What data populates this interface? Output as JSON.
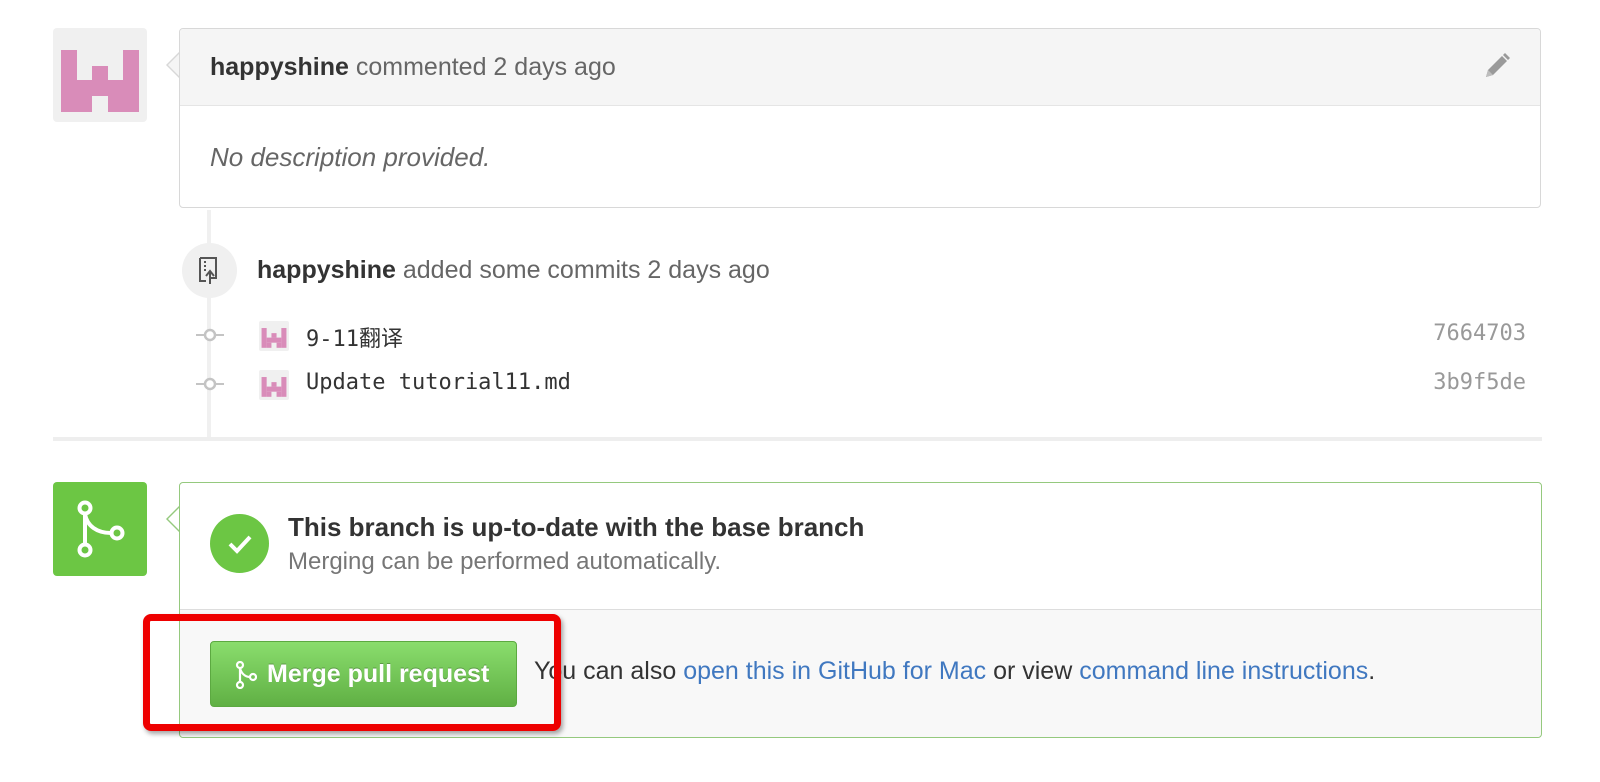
{
  "comment": {
    "author": "happyshine",
    "action": "commented 2 days ago",
    "body": "No description provided."
  },
  "commit_event": {
    "author": "happyshine",
    "action": "added some commits 2 days ago",
    "commits": [
      {
        "message": "9-11翻译",
        "sha": "7664703"
      },
      {
        "message": "Update tutorial11.md",
        "sha": "3b9f5de"
      }
    ]
  },
  "merge": {
    "status_title": "This branch is up-to-date with the base branch",
    "status_subtitle": "Merging can be performed automatically.",
    "button_label": "Merge pull request",
    "help_prefix": "You can also",
    "help_link_mac": "open this in GitHub for Mac",
    "help_middle": "or view",
    "help_link_cli": "command line instructions",
    "help_suffix": "."
  },
  "icons": {
    "edit": "pencil-icon",
    "push": "repo-push-icon",
    "commit": "git-commit-icon",
    "merge": "git-merge-icon",
    "check": "check-icon"
  },
  "colors": {
    "success_green": "#6cc644",
    "link_blue": "#4078c0",
    "highlight_red": "#ee0000",
    "avatar_pink": "#d98cb9"
  }
}
